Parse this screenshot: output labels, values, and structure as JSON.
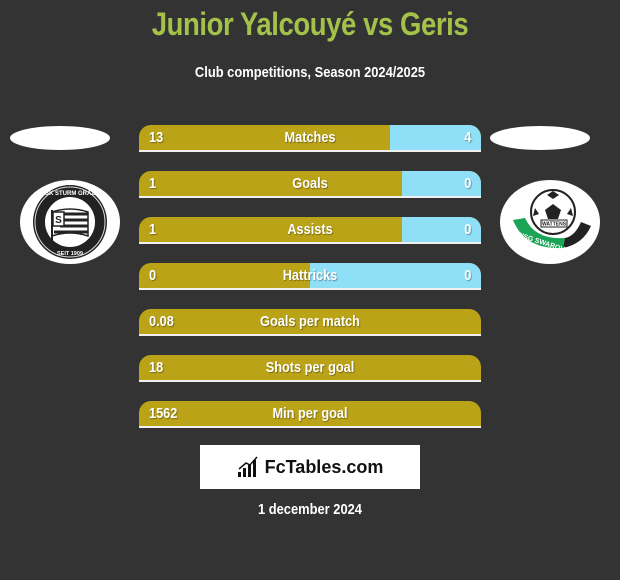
{
  "header": {
    "title": "Junior Yalcouyé vs Geris",
    "subtitle": "Club competitions, Season 2024/2025"
  },
  "teams": {
    "left": {
      "name": "SK Sturm Graz",
      "logo_top_text": "SK STURM GRAZ",
      "logo_bottom_text": "SEIT 1909"
    },
    "right": {
      "name": "WSG Swarovski Wattens",
      "logo_text": "WSG SWAROVSKI",
      "logo_center_text": "WATTENS"
    }
  },
  "colors": {
    "title": "#a4c14a",
    "left_bar": "#bba318",
    "right_bar": "#8fdff7",
    "background": "#333333"
  },
  "stats": [
    {
      "label": "Matches",
      "left": "13",
      "right": "4",
      "left_share": 0.735
    },
    {
      "label": "Goals",
      "left": "1",
      "right": "0",
      "left_share": 0.77
    },
    {
      "label": "Assists",
      "left": "1",
      "right": "0",
      "left_share": 0.77
    },
    {
      "label": "Hattricks",
      "left": "0",
      "right": "0",
      "left_share": 0.5
    },
    {
      "label": "Goals per match",
      "left": "0.08",
      "right": null,
      "left_share": 1
    },
    {
      "label": "Shots per goal",
      "left": "18",
      "right": null,
      "left_share": 1
    },
    {
      "label": "Min per goal",
      "left": "1562",
      "right": null,
      "left_share": 1
    }
  ],
  "brand": {
    "name": "FcTables.com",
    "icon": "bar-chart-icon"
  },
  "footer": {
    "date": "1 december 2024"
  }
}
